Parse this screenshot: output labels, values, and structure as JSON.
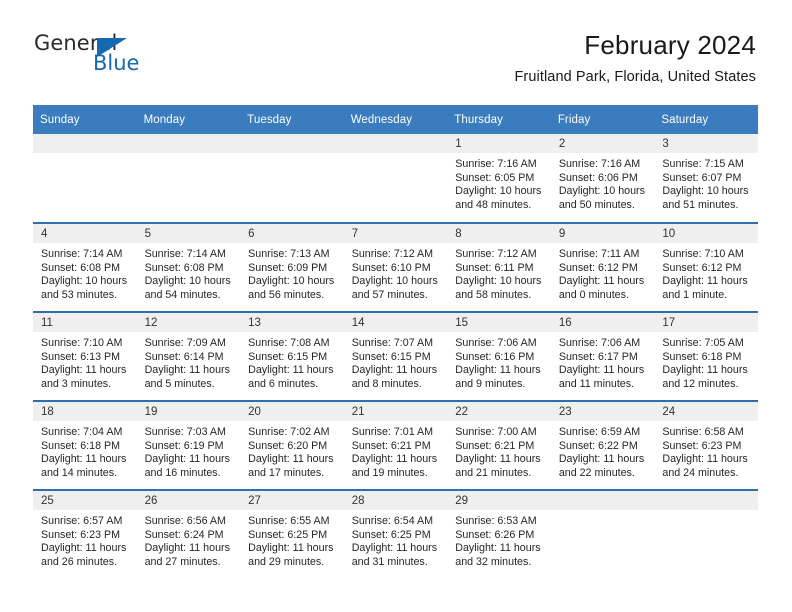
{
  "logo": {
    "word_one": "General",
    "word_two": "Blue",
    "triangle_icon": "triangle-icon",
    "accent_color": "#1569b0"
  },
  "header": {
    "title": "February 2024",
    "subtitle": "Fruitland Park, Florida, United States"
  },
  "calendar": {
    "header_bg": "#3a7cbe",
    "daynum_bg": "#efefef",
    "separator_color": "#2f6fac",
    "weekday_headers": [
      "Sunday",
      "Monday",
      "Tuesday",
      "Wednesday",
      "Thursday",
      "Friday",
      "Saturday"
    ],
    "weeks": [
      [
        {
          "day": "",
          "sunrise": "",
          "sunset": "",
          "daylight_line1": "",
          "daylight_line2": "",
          "empty": true
        },
        {
          "day": "",
          "sunrise": "",
          "sunset": "",
          "daylight_line1": "",
          "daylight_line2": "",
          "empty": true
        },
        {
          "day": "",
          "sunrise": "",
          "sunset": "",
          "daylight_line1": "",
          "daylight_line2": "",
          "empty": true
        },
        {
          "day": "",
          "sunrise": "",
          "sunset": "",
          "daylight_line1": "",
          "daylight_line2": "",
          "empty": true
        },
        {
          "day": "1",
          "sunrise": "Sunrise: 7:16 AM",
          "sunset": "Sunset: 6:05 PM",
          "daylight_line1": "Daylight: 10 hours",
          "daylight_line2": "and 48 minutes."
        },
        {
          "day": "2",
          "sunrise": "Sunrise: 7:16 AM",
          "sunset": "Sunset: 6:06 PM",
          "daylight_line1": "Daylight: 10 hours",
          "daylight_line2": "and 50 minutes."
        },
        {
          "day": "3",
          "sunrise": "Sunrise: 7:15 AM",
          "sunset": "Sunset: 6:07 PM",
          "daylight_line1": "Daylight: 10 hours",
          "daylight_line2": "and 51 minutes."
        }
      ],
      [
        {
          "day": "4",
          "sunrise": "Sunrise: 7:14 AM",
          "sunset": "Sunset: 6:08 PM",
          "daylight_line1": "Daylight: 10 hours",
          "daylight_line2": "and 53 minutes."
        },
        {
          "day": "5",
          "sunrise": "Sunrise: 7:14 AM",
          "sunset": "Sunset: 6:08 PM",
          "daylight_line1": "Daylight: 10 hours",
          "daylight_line2": "and 54 minutes."
        },
        {
          "day": "6",
          "sunrise": "Sunrise: 7:13 AM",
          "sunset": "Sunset: 6:09 PM",
          "daylight_line1": "Daylight: 10 hours",
          "daylight_line2": "and 56 minutes."
        },
        {
          "day": "7",
          "sunrise": "Sunrise: 7:12 AM",
          "sunset": "Sunset: 6:10 PM",
          "daylight_line1": "Daylight: 10 hours",
          "daylight_line2": "and 57 minutes."
        },
        {
          "day": "8",
          "sunrise": "Sunrise: 7:12 AM",
          "sunset": "Sunset: 6:11 PM",
          "daylight_line1": "Daylight: 10 hours",
          "daylight_line2": "and 58 minutes."
        },
        {
          "day": "9",
          "sunrise": "Sunrise: 7:11 AM",
          "sunset": "Sunset: 6:12 PM",
          "daylight_line1": "Daylight: 11 hours",
          "daylight_line2": "and 0 minutes."
        },
        {
          "day": "10",
          "sunrise": "Sunrise: 7:10 AM",
          "sunset": "Sunset: 6:12 PM",
          "daylight_line1": "Daylight: 11 hours",
          "daylight_line2": "and 1 minute."
        }
      ],
      [
        {
          "day": "11",
          "sunrise": "Sunrise: 7:10 AM",
          "sunset": "Sunset: 6:13 PM",
          "daylight_line1": "Daylight: 11 hours",
          "daylight_line2": "and 3 minutes."
        },
        {
          "day": "12",
          "sunrise": "Sunrise: 7:09 AM",
          "sunset": "Sunset: 6:14 PM",
          "daylight_line1": "Daylight: 11 hours",
          "daylight_line2": "and 5 minutes."
        },
        {
          "day": "13",
          "sunrise": "Sunrise: 7:08 AM",
          "sunset": "Sunset: 6:15 PM",
          "daylight_line1": "Daylight: 11 hours",
          "daylight_line2": "and 6 minutes."
        },
        {
          "day": "14",
          "sunrise": "Sunrise: 7:07 AM",
          "sunset": "Sunset: 6:15 PM",
          "daylight_line1": "Daylight: 11 hours",
          "daylight_line2": "and 8 minutes."
        },
        {
          "day": "15",
          "sunrise": "Sunrise: 7:06 AM",
          "sunset": "Sunset: 6:16 PM",
          "daylight_line1": "Daylight: 11 hours",
          "daylight_line2": "and 9 minutes."
        },
        {
          "day": "16",
          "sunrise": "Sunrise: 7:06 AM",
          "sunset": "Sunset: 6:17 PM",
          "daylight_line1": "Daylight: 11 hours",
          "daylight_line2": "and 11 minutes."
        },
        {
          "day": "17",
          "sunrise": "Sunrise: 7:05 AM",
          "sunset": "Sunset: 6:18 PM",
          "daylight_line1": "Daylight: 11 hours",
          "daylight_line2": "and 12 minutes."
        }
      ],
      [
        {
          "day": "18",
          "sunrise": "Sunrise: 7:04 AM",
          "sunset": "Sunset: 6:18 PM",
          "daylight_line1": "Daylight: 11 hours",
          "daylight_line2": "and 14 minutes."
        },
        {
          "day": "19",
          "sunrise": "Sunrise: 7:03 AM",
          "sunset": "Sunset: 6:19 PM",
          "daylight_line1": "Daylight: 11 hours",
          "daylight_line2": "and 16 minutes."
        },
        {
          "day": "20",
          "sunrise": "Sunrise: 7:02 AM",
          "sunset": "Sunset: 6:20 PM",
          "daylight_line1": "Daylight: 11 hours",
          "daylight_line2": "and 17 minutes."
        },
        {
          "day": "21",
          "sunrise": "Sunrise: 7:01 AM",
          "sunset": "Sunset: 6:21 PM",
          "daylight_line1": "Daylight: 11 hours",
          "daylight_line2": "and 19 minutes."
        },
        {
          "day": "22",
          "sunrise": "Sunrise: 7:00 AM",
          "sunset": "Sunset: 6:21 PM",
          "daylight_line1": "Daylight: 11 hours",
          "daylight_line2": "and 21 minutes."
        },
        {
          "day": "23",
          "sunrise": "Sunrise: 6:59 AM",
          "sunset": "Sunset: 6:22 PM",
          "daylight_line1": "Daylight: 11 hours",
          "daylight_line2": "and 22 minutes."
        },
        {
          "day": "24",
          "sunrise": "Sunrise: 6:58 AM",
          "sunset": "Sunset: 6:23 PM",
          "daylight_line1": "Daylight: 11 hours",
          "daylight_line2": "and 24 minutes."
        }
      ],
      [
        {
          "day": "25",
          "sunrise": "Sunrise: 6:57 AM",
          "sunset": "Sunset: 6:23 PM",
          "daylight_line1": "Daylight: 11 hours",
          "daylight_line2": "and 26 minutes."
        },
        {
          "day": "26",
          "sunrise": "Sunrise: 6:56 AM",
          "sunset": "Sunset: 6:24 PM",
          "daylight_line1": "Daylight: 11 hours",
          "daylight_line2": "and 27 minutes."
        },
        {
          "day": "27",
          "sunrise": "Sunrise: 6:55 AM",
          "sunset": "Sunset: 6:25 PM",
          "daylight_line1": "Daylight: 11 hours",
          "daylight_line2": "and 29 minutes."
        },
        {
          "day": "28",
          "sunrise": "Sunrise: 6:54 AM",
          "sunset": "Sunset: 6:25 PM",
          "daylight_line1": "Daylight: 11 hours",
          "daylight_line2": "and 31 minutes."
        },
        {
          "day": "29",
          "sunrise": "Sunrise: 6:53 AM",
          "sunset": "Sunset: 6:26 PM",
          "daylight_line1": "Daylight: 11 hours",
          "daylight_line2": "and 32 minutes."
        },
        {
          "day": "",
          "sunrise": "",
          "sunset": "",
          "daylight_line1": "",
          "daylight_line2": "",
          "empty": true
        },
        {
          "day": "",
          "sunrise": "",
          "sunset": "",
          "daylight_line1": "",
          "daylight_line2": "",
          "empty": true
        }
      ]
    ]
  }
}
